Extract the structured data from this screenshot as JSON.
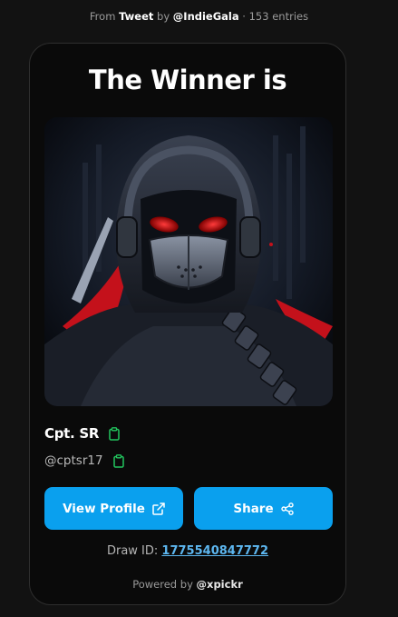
{
  "source": {
    "prefix": "From",
    "platform": "Tweet",
    "by_label": "by",
    "author": "@IndieGala",
    "separator": "·",
    "entries": "153 entries"
  },
  "card": {
    "title": "The Winner is",
    "winner_name": "Cpt. SR",
    "winner_handle": "@cptsr17",
    "view_profile_label": "View Profile",
    "share_label": "Share",
    "draw_id_label": "Draw ID:",
    "draw_id_value": "1775540847772",
    "powered_by_label": "Powered by",
    "powered_by_brand": "@xpickr"
  },
  "icons": {
    "copy": "clipboard-icon",
    "external": "external-link-icon",
    "share": "share-nodes-icon"
  },
  "colors": {
    "background": "#121212",
    "card": "#0a0a0a",
    "accent": "#0aa0ee",
    "copy_icon": "#22c55e",
    "link": "#5db7f0"
  }
}
